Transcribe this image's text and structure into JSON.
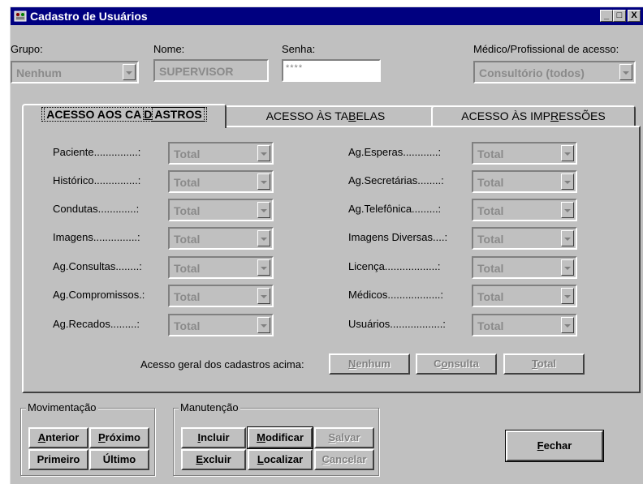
{
  "window": {
    "title": "Cadastro de Usuários",
    "buttons": {
      "minimize": "_",
      "maximize": "□",
      "close": "X"
    }
  },
  "header": {
    "grupo_label": "Grupo:",
    "grupo_value": "Nenhum",
    "nome_label": "Nome:",
    "nome_value": "SUPERVISOR",
    "senha_label": "Senha:",
    "senha_value": "****",
    "medico_label": "Médico/Profissional de acesso:",
    "medico_value": "Consultório (todos)"
  },
  "tabs": [
    {
      "label": "ACESSO AOS CADASTROS",
      "pre": "ACESSO AOS CA",
      "u": "D",
      "post": "ASTROS"
    },
    {
      "label": "ACESSO ÀS TABELAS",
      "pre": "ACESSO ÀS TA",
      "u": "B",
      "post": "ELAS"
    },
    {
      "label": "ACESSO ÀS IMPRESSÕES",
      "pre": "ACESSO ÀS IMP",
      "u": "R",
      "post": "ESSÕES"
    }
  ],
  "left_fields": [
    {
      "label": "Paciente...............:",
      "value": "Total"
    },
    {
      "label": "Histórico...............:",
      "value": "Total"
    },
    {
      "label": "Condutas.............:",
      "value": "Total"
    },
    {
      "label": "Imagens...............:",
      "value": "Total"
    },
    {
      "label": "Ag.Consultas........:",
      "value": "Total"
    },
    {
      "label": "Ag.Compromissos.:",
      "value": "Total"
    },
    {
      "label": "Ag.Recados.........:",
      "value": "Total"
    }
  ],
  "right_fields": [
    {
      "label": "Ag.Esperas............:",
      "value": "Total"
    },
    {
      "label": "Ag.Secretárias........:",
      "value": "Total"
    },
    {
      "label": "Ag.Telefônica.........:",
      "value": "Total"
    },
    {
      "label": "Imagens Diversas....:",
      "value": "Total"
    },
    {
      "label": "Licença..................:",
      "value": "Total"
    },
    {
      "label": "Médicos..................:",
      "value": "Total"
    },
    {
      "label": "Usuários..................:",
      "value": "Total"
    }
  ],
  "geral": {
    "label": "Acesso geral dos cadastros acima:",
    "nenhum": {
      "u": "N",
      "rest": "enhum"
    },
    "consulta": {
      "pre": "C",
      "u": "o",
      "rest": "nsulta"
    },
    "total": {
      "u": "T",
      "rest": "otal"
    }
  },
  "movimentacao": {
    "label": "Movimentação",
    "anterior": {
      "u": "A",
      "rest": "nterior"
    },
    "proximo": {
      "u": "P",
      "rest": "róximo"
    },
    "primeiro": "Primeiro",
    "ultimo": "Último"
  },
  "manutencao": {
    "label": "Manutenção",
    "incluir": {
      "u": "I",
      "rest": "ncluir"
    },
    "modificar": {
      "u": "M",
      "rest": "odificar"
    },
    "salvar": {
      "u": "S",
      "rest": "alvar"
    },
    "excluir": {
      "u": "E",
      "rest": "xcluir"
    },
    "localizar": {
      "u": "L",
      "rest": "ocalizar"
    },
    "cancelar": {
      "u": "C",
      "rest": "ancelar"
    }
  },
  "fechar": {
    "u": "F",
    "rest": "echar"
  }
}
